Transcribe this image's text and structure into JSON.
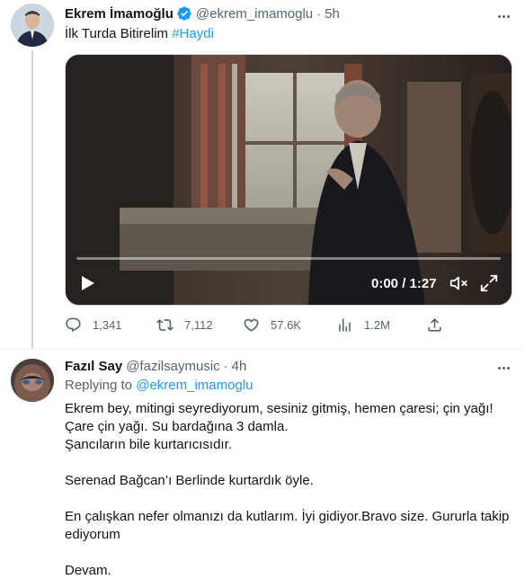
{
  "tweet": {
    "author_name": "Ekrem İmamoğlu",
    "author_handle": "@ekrem_imamoglu",
    "dot": "·",
    "time": "5h",
    "text": "İlk Turda Bitirelim",
    "hashtag": "#Haydi",
    "video": {
      "timecode": "0:00 / 1:27",
      "progress": 0
    },
    "stats": {
      "replies": "1,341",
      "retweets": "7,112",
      "likes": "57.6K",
      "views": "1.2M"
    }
  },
  "reply": {
    "author_name": "Fazıl Say",
    "author_handle": "@fazilsaymusic",
    "dot": "·",
    "time": "4h",
    "replying_label": "Replying to",
    "replying_handle": "@ekrem_imamoglu",
    "lines": [
      "Ekrem bey, mitingi seyrediyorum, sesiniz gitmiş, hemen çaresi; çin yağı!",
      "Çare çin yağı. Su bardağına 3 damla.",
      "Şancıların bile kurtarıcısıdır.",
      "",
      "Serenad Bağcan’ı Berlinde kurtardık öyle.",
      "",
      "En çalışkan nefer olmanızı da kutlarım. İyi gidiyor.Bravo size. Gururla takip",
      "ediyorum",
      "",
      "Devam."
    ]
  },
  "icons": {
    "verified": "verified-badge-icon",
    "more": "more-dots-icon",
    "reply": "reply-bubble-icon",
    "retweet": "retweet-icon",
    "like": "heart-icon",
    "views": "views-bar-chart-icon",
    "share": "share-upload-icon",
    "play": "play-icon",
    "mute": "muted-speaker-icon",
    "fullscreen": "fullscreen-icon"
  },
  "colors": {
    "accent": "#1d9bf0",
    "text": "#0f1419",
    "muted": "#536471",
    "border": "#cfd9de"
  }
}
